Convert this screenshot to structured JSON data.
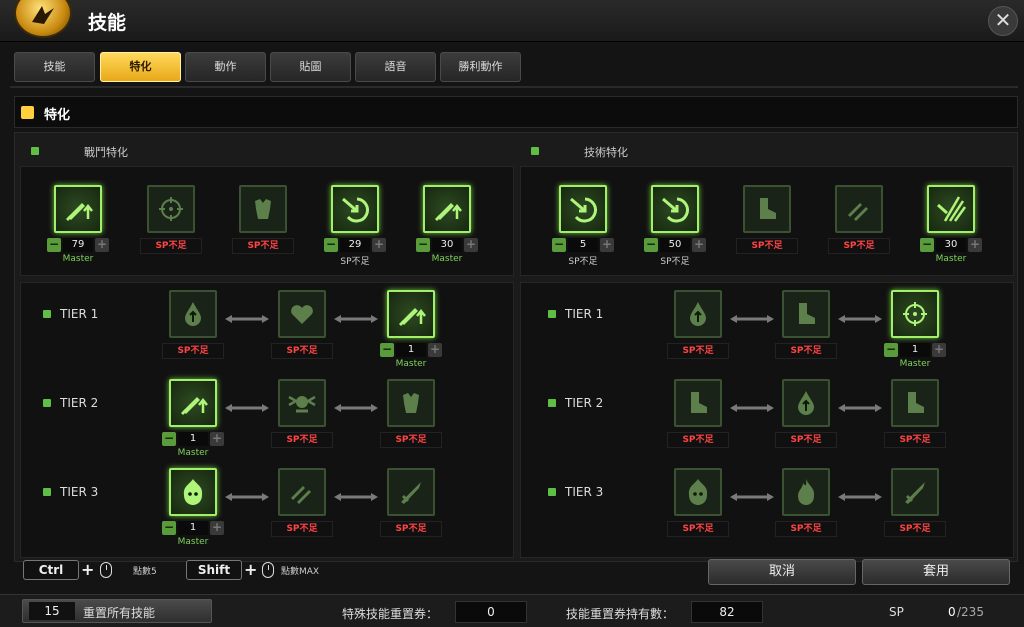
{
  "window": {
    "title": "技能",
    "close_label": "✕"
  },
  "tabs": [
    {
      "label": "技能",
      "active": false
    },
    {
      "label": "特化",
      "active": true
    },
    {
      "label": "動作",
      "active": false
    },
    {
      "label": "貼圖",
      "active": false
    },
    {
      "label": "語音",
      "active": false
    },
    {
      "label": "勝利動作",
      "active": false
    }
  ],
  "section": {
    "title": "特化"
  },
  "left": {
    "title": "戰鬥特化",
    "skills": [
      {
        "icon": "sword-up-icon",
        "state": "on",
        "value": "79",
        "note": "Master"
      },
      {
        "icon": "crosshair-up-icon",
        "state": "dim",
        "sp": "SP不足"
      },
      {
        "icon": "armor-up-icon",
        "state": "dim",
        "sp": "SP不足"
      },
      {
        "icon": "slash-shield-icon",
        "state": "on",
        "value": "29",
        "note": "SP不足"
      },
      {
        "icon": "sword-up-icon",
        "state": "on",
        "value": "30",
        "note": "Master"
      }
    ],
    "tiers": [
      {
        "label": "TIER 1",
        "nodes": [
          {
            "icon": "blood-drop-icon",
            "state": "dim",
            "sp": "SP不足"
          },
          {
            "icon": "heart-up-icon",
            "state": "dim",
            "sp": "SP不足"
          },
          {
            "icon": "sword-up-icon",
            "state": "on",
            "value": "1",
            "note": "Master"
          }
        ]
      },
      {
        "label": "TIER 2",
        "nodes": [
          {
            "icon": "sword-up-icon",
            "state": "on",
            "value": "1",
            "note": "Master"
          },
          {
            "icon": "skull-wings-icon",
            "state": "dim",
            "sp": "SP不足"
          },
          {
            "icon": "armor-up-icon",
            "state": "dim",
            "sp": "SP不足"
          }
        ]
      },
      {
        "label": "TIER 3",
        "nodes": [
          {
            "icon": "flame-demon-icon",
            "state": "on",
            "value": "1",
            "note": "Master"
          },
          {
            "icon": "double-sword-icon",
            "state": "dim",
            "sp": "SP不足"
          },
          {
            "icon": "sword-icon",
            "state": "dim",
            "sp": "SP不足"
          }
        ]
      }
    ]
  },
  "right": {
    "title": "技術特化",
    "skills": [
      {
        "icon": "slash-shield-icon",
        "state": "on",
        "value": "5",
        "note": "SP不足"
      },
      {
        "icon": "slash-shield-icon",
        "state": "on",
        "value": "50",
        "note": "SP不足"
      },
      {
        "icon": "boot-up-icon",
        "state": "dim",
        "sp": "SP不足"
      },
      {
        "icon": "double-sword-icon",
        "state": "dim",
        "sp": "SP不足"
      },
      {
        "icon": "claw-slash-icon",
        "state": "on",
        "value": "30",
        "note": "Master"
      }
    ],
    "tiers": [
      {
        "label": "TIER 1",
        "nodes": [
          {
            "icon": "blood-drop-icon",
            "state": "dim",
            "sp": "SP不足"
          },
          {
            "icon": "boot-up-icon",
            "state": "dim",
            "sp": "SP不足"
          },
          {
            "icon": "crosshair-up-icon",
            "state": "on",
            "value": "1",
            "note": "Master"
          }
        ]
      },
      {
        "label": "TIER 2",
        "nodes": [
          {
            "icon": "boot-up-icon",
            "state": "dim",
            "sp": "SP不足"
          },
          {
            "icon": "blood-drop-icon",
            "state": "dim",
            "sp": "SP不足"
          },
          {
            "icon": "boot-up-icon",
            "state": "dim",
            "sp": "SP不足"
          }
        ]
      },
      {
        "label": "TIER 3",
        "nodes": [
          {
            "icon": "flame-demon-icon",
            "state": "dim",
            "sp": "SP不足"
          },
          {
            "icon": "flame-icon",
            "state": "dim",
            "sp": "SP不足"
          },
          {
            "icon": "sword-icon",
            "state": "dim",
            "sp": "SP不足"
          }
        ]
      }
    ]
  },
  "hints": {
    "ctrl": "Ctrl",
    "ctrl_text": "點數5",
    "shift": "Shift",
    "shift_text": "點數MAX"
  },
  "buttons": {
    "cancel": "取消",
    "apply": "套用"
  },
  "bottom": {
    "reset_count": "15",
    "reset_label": "重置所有技能",
    "special_label": "特殊技能重置券：",
    "special_value": "0",
    "owned_label": "技能重置券持有數：",
    "owned_value": "82",
    "sp_label": "SP",
    "sp_current": "0",
    "sp_total": "/235"
  },
  "colors": {
    "accent": "#ffcf3d",
    "active_green": "#a0f06a",
    "warn_red": "#ff4444",
    "master_green": "#7fd35a"
  }
}
